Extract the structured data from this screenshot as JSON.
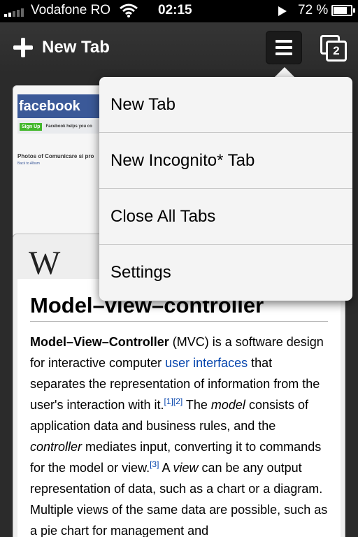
{
  "status_bar": {
    "carrier": "Vodafone RO",
    "time": "02:15",
    "battery_percent": "72 %"
  },
  "toolbar": {
    "new_tab_label": "New Tab",
    "open_tabs_count": "2"
  },
  "menu": {
    "items": [
      {
        "label": "New Tab"
      },
      {
        "label": "New Incognito* Tab"
      },
      {
        "label": "Close All Tabs"
      },
      {
        "label": "Settings"
      }
    ]
  },
  "tabs": {
    "facebook": {
      "logo_text": "facebook",
      "signup_label": "Sign Up",
      "helper_text": "Facebook helps you co",
      "photos_text": "Photos of Comunicare si pro",
      "back_link": "Back to Album"
    },
    "wikipedia": {
      "logo": "W",
      "title": "Model–view–controller",
      "body": {
        "term": "Model–View–Controller",
        "t1": " (MVC) is a software design for interactive computer ",
        "link": "user interfaces",
        "t2": " that separates the representation of information from the user's interaction with it.",
        "ref1": "[1][2]",
        "t3": " The ",
        "model": "model",
        "t4": " consists of application data and business rules, and the ",
        "controller": "controller",
        "t5": " mediates input, converting it to commands for the model or view.",
        "ref2": "[3]",
        "t6": " A ",
        "view": "view",
        "t7": " can be any output representation of data, such as a chart or a diagram. Multiple views of the same data are possible, such as a pie chart for management and"
      }
    }
  },
  "colors": {
    "facebook_blue": "#3b5998",
    "link_blue": "#0645ad",
    "toolbar_bg": "#2b2b2b"
  }
}
